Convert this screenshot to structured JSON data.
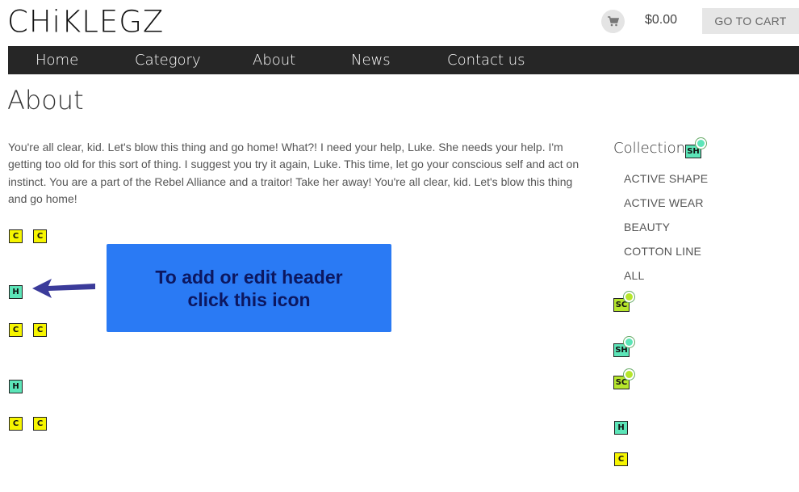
{
  "header": {
    "logo": "CHiKLEGZ",
    "cart_icon": "shopping-cart-icon",
    "cart_total": "$0.00",
    "go_to_cart": "GO TO CART"
  },
  "nav": {
    "items": [
      {
        "label": "Home"
      },
      {
        "label": "Category"
      },
      {
        "label": "About"
      },
      {
        "label": "News"
      },
      {
        "label": "Contact us"
      }
    ]
  },
  "main": {
    "title": "About",
    "paragraph": "You're all clear, kid. Let's blow this thing and go home! What?! I need your help, Luke. She needs your help. I'm getting too old for this sort of thing. I suggest you try it again, Luke. This time, let go your conscious self and act on instinct. You are a part of the Rebel Alliance and a traitor! Take her away! You're all clear, kid. Let's blow this thing and go home!"
  },
  "tags": {
    "c": "C",
    "h": "H",
    "sh": "SH",
    "sc": "SC"
  },
  "callout": {
    "line1": "To add or edit header",
    "line2": "click this icon"
  },
  "sidebar": {
    "title": "Collections",
    "items": [
      {
        "label": "ACTIVE SHAPE"
      },
      {
        "label": "ACTIVE WEAR"
      },
      {
        "label": "BEAUTY"
      },
      {
        "label": "COTTON LINE"
      },
      {
        "label": "ALL"
      }
    ]
  },
  "colors": {
    "nav_bg": "#262626",
    "callout_bg": "#2a7af4",
    "callout_text": "#0c1760",
    "tag_content": "#f6f500",
    "tag_header": "#5ce5b8",
    "tag_section": "#b6e62c",
    "arrow": "#3b3b9a"
  }
}
